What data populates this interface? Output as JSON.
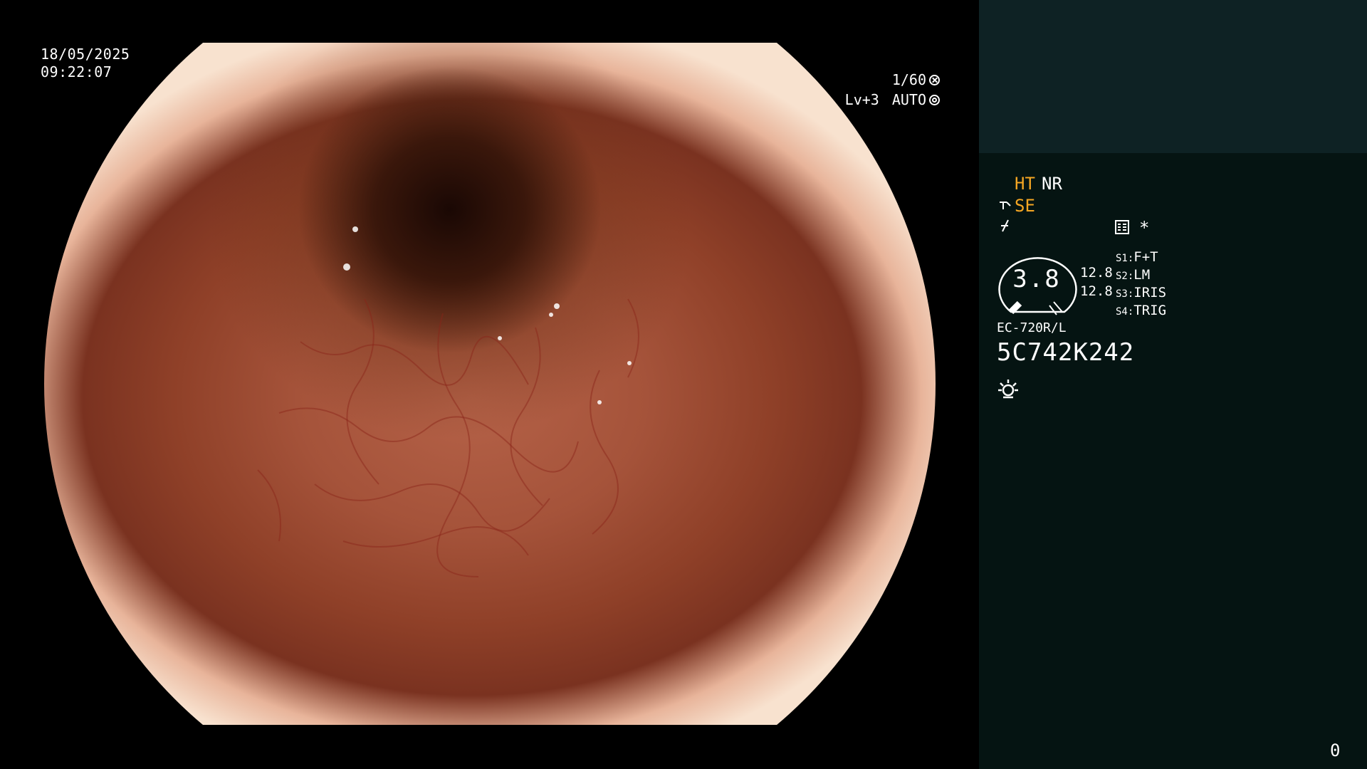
{
  "osd": {
    "date": "18/05/2025",
    "time": "09:22:07",
    "shutter": "1/60",
    "level": "Lv+3",
    "mode": "AUTO"
  },
  "panel": {
    "ht": "HT",
    "nr": "NR",
    "se": "SE",
    "asterisk": "*",
    "gauge_value": "3.8",
    "gauge_sub_1": "12.8",
    "gauge_sub_2": "12.8",
    "switches": [
      {
        "key": "S1:",
        "value": "F+T"
      },
      {
        "key": "S2:",
        "value": "LM"
      },
      {
        "key": "S3:",
        "value": "IRIS"
      },
      {
        "key": "S4:",
        "value": "TRIG"
      }
    ],
    "model": "EC-720R/L",
    "serial": "5C742K242",
    "counter": "0"
  },
  "colors": {
    "accent_orange": "#f5a623",
    "panel_top": "#0e2224",
    "panel_bottom": "#051412"
  },
  "icons": [
    "shutter-icon",
    "auto-iris-icon",
    "scope-icon",
    "freeze-icon",
    "menu-grid-icon",
    "gauge-icon",
    "light-icon"
  ]
}
